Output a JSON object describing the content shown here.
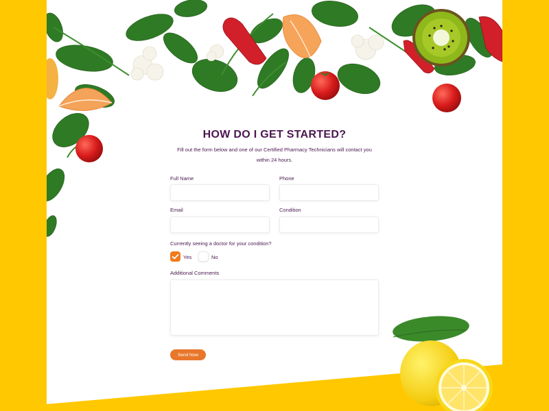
{
  "colors": {
    "background": "#FFC800",
    "heading": "#4B1650",
    "accent": "#E8772B",
    "checkbox": "#F07A1C"
  },
  "header": {
    "title": "HOW DO I GET STARTED?",
    "intro": "Fill out the form below and one of our Certified Pharmacy Technicians will contact you within 24 hours."
  },
  "form": {
    "full_name_label": "Full Name",
    "full_name_value": "",
    "phone_label": "Phone",
    "phone_value": "",
    "email_label": "Email",
    "email_value": "",
    "condition_label": "Condition",
    "condition_value": "",
    "doctor_question": "Currently seeing a doctor for your condition?",
    "yes_label": "Yes",
    "no_label": "No",
    "selected_option": "Yes",
    "comments_label": "Additional Comments",
    "comments_value": "",
    "submit_label": "Send Now"
  },
  "decor_icons": [
    "spinach-leaf-icon",
    "red-pepper-icon",
    "tangerine-icon",
    "cauliflower-icon",
    "kiwi-icon",
    "cherry-tomato-icon",
    "lemon-icon"
  ]
}
